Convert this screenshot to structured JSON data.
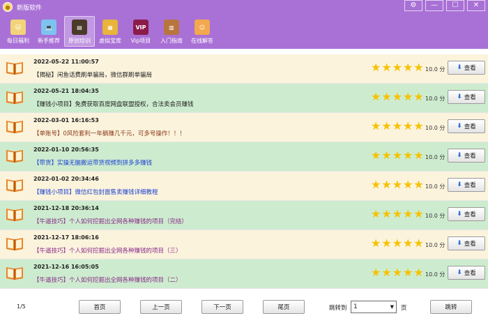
{
  "window": {
    "title": "新版软件",
    "controls": [
      "⚙",
      "—",
      "☐",
      "✕"
    ]
  },
  "toolbar": {
    "items": [
      {
        "label": "每日福利",
        "icon": "lucky-cat-icon",
        "glyph": "🐱",
        "color": "#f2d37a"
      },
      {
        "label": "新手推荐",
        "icon": "computer-icon",
        "glyph": "💻",
        "color": "#7cc3f0"
      },
      {
        "label": "原创培训",
        "icon": "training-board-icon",
        "glyph": "▤",
        "color": "#4b3a2a",
        "active": true
      },
      {
        "label": "虚拟宝库",
        "icon": "treasure-icon",
        "glyph": "▦",
        "color": "#e8b43a"
      },
      {
        "label": "Vip项目",
        "icon": "vip-icon",
        "glyph": "VIP",
        "color": "#8b1c4a"
      },
      {
        "label": "入门指南",
        "icon": "guide-book-icon",
        "glyph": "▥",
        "color": "#b8753d"
      },
      {
        "label": "在线解答",
        "icon": "support-girl-icon",
        "glyph": "☺",
        "color": "#f3a84f"
      }
    ]
  },
  "list": {
    "items": [
      {
        "date": "2022-05-22 11:00:57",
        "tag": "【揭秘】",
        "title": "闲鱼话费刷单骗局，微信群刷单骗局",
        "score": "10.0 分",
        "button": "查看",
        "title_color": "#222222",
        "tag_color": "#222222"
      },
      {
        "date": "2022-05-21 18:04:35",
        "tag": "【赚钱小项目】",
        "title": "免费获取百度网盘联盟授权，合法卖会员赚钱",
        "score": "10.0 分",
        "button": "查看",
        "title_color": "#222222",
        "tag_color": "#222222"
      },
      {
        "date": "2022-03-01 16:16:53",
        "tag": "【单账号】",
        "title": "0风险套利一年躺赚几千元，可多号操作！！！",
        "score": "10.0 分",
        "button": "查看",
        "title_color": "#8a3a1a",
        "tag_color": "#8a3a1a"
      },
      {
        "date": "2022-01-10 20:56:35",
        "tag": "【带货】",
        "title": "实操无脑搬运带货视频到拼多多赚钱",
        "score": "10.0 分",
        "button": "查看",
        "title_color": "#1a3fd0",
        "tag_color": "#1a3fd0"
      },
      {
        "date": "2022-01-02 20:34:46",
        "tag": "【赚钱小项目】",
        "title": "微信红包封面售卖赚钱详细教程",
        "score": "10.0 分",
        "button": "查看",
        "title_color": "#1a3fd0",
        "tag_color": "#1a3fd0"
      },
      {
        "date": "2021-12-18 20:36:14",
        "tag": "【牛逼技巧】",
        "title": "个人如何挖掘出全网各种赚钱的项目（完结）",
        "score": "10.0 分",
        "button": "查看",
        "title_color": "#8a2a8a",
        "tag_color": "#8a2a8a"
      },
      {
        "date": "2021-12-17 18:06:16",
        "tag": "【牛逼技巧】",
        "title": "个人如何挖掘出全网各种赚钱的项目（三）",
        "score": "10.0 分",
        "button": "查看",
        "title_color": "#8a2a8a",
        "tag_color": "#8a2a8a"
      },
      {
        "date": "2021-12-16 16:05:05",
        "tag": "【牛逼技巧】",
        "title": "个人如何挖掘出全网各种赚钱的项目（二）",
        "score": "10.0 分",
        "button": "查看",
        "title_color": "#8a2a8a",
        "tag_color": "#8a2a8a"
      }
    ],
    "stars": 5
  },
  "pager": {
    "page_indicator": "1/5",
    "first": "首页",
    "prev": "上一页",
    "next": "下一页",
    "last": "尾页",
    "jump_label": "跳转到",
    "jump_value": "1",
    "page_unit": "页",
    "jump_button": "跳转"
  },
  "colors": {
    "accent": "#a971d6",
    "row_odd": "#fbf3dc",
    "row_even": "#cdeccf",
    "star": "#f6c200"
  }
}
